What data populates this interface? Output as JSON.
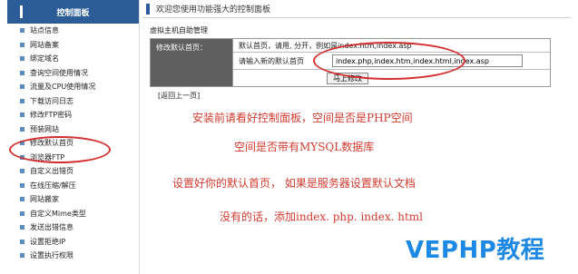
{
  "sidebar": {
    "title": "控制面板",
    "items": [
      {
        "label": "站点信息"
      },
      {
        "label": "网站备案"
      },
      {
        "label": "绑定域名"
      },
      {
        "label": "查询空间使用情况"
      },
      {
        "label": "流量及CPU使用情况"
      },
      {
        "label": "下载访问日志"
      },
      {
        "label": "修改FTP密码"
      },
      {
        "label": "预装网站"
      },
      {
        "label": "修改默认首页"
      },
      {
        "label": "浏览器FTP"
      },
      {
        "label": "自定义出错页"
      },
      {
        "label": "在线压缩/解压"
      },
      {
        "label": "网站搬家"
      },
      {
        "label": "自定义Mime类型"
      },
      {
        "label": "发送出错信息"
      },
      {
        "label": "设置拒绝IP"
      },
      {
        "label": "设置执行权限"
      }
    ]
  },
  "topbar": {
    "text": "欢迎您使用功能强大的控制面板"
  },
  "panel": {
    "title": "虚拟主机自助管理",
    "row_label": "修改默认首页：",
    "hint": "默认首页，请用, 分开，例如是index.htm,index.asp",
    "input_label": "请输入新的默认首页",
    "input_value": "index.php,index.htm,index.html,index.asp",
    "submit_label": "马上修改"
  },
  "back_link": "[返回上一页]",
  "notes": [
    "安装前请看好控制面板，空间是否是PHP空间",
    "空间是否带有MYSQL数据库",
    "设置好你的默认首页，  如果是服务器设置默认文档",
    "没有的话，添加index. php. index. html"
  ],
  "watermark": "VEPHP教程",
  "colors": {
    "accent": "#2b5c97",
    "annotation": "#d23a2f",
    "watermark": "#1e88e5"
  }
}
